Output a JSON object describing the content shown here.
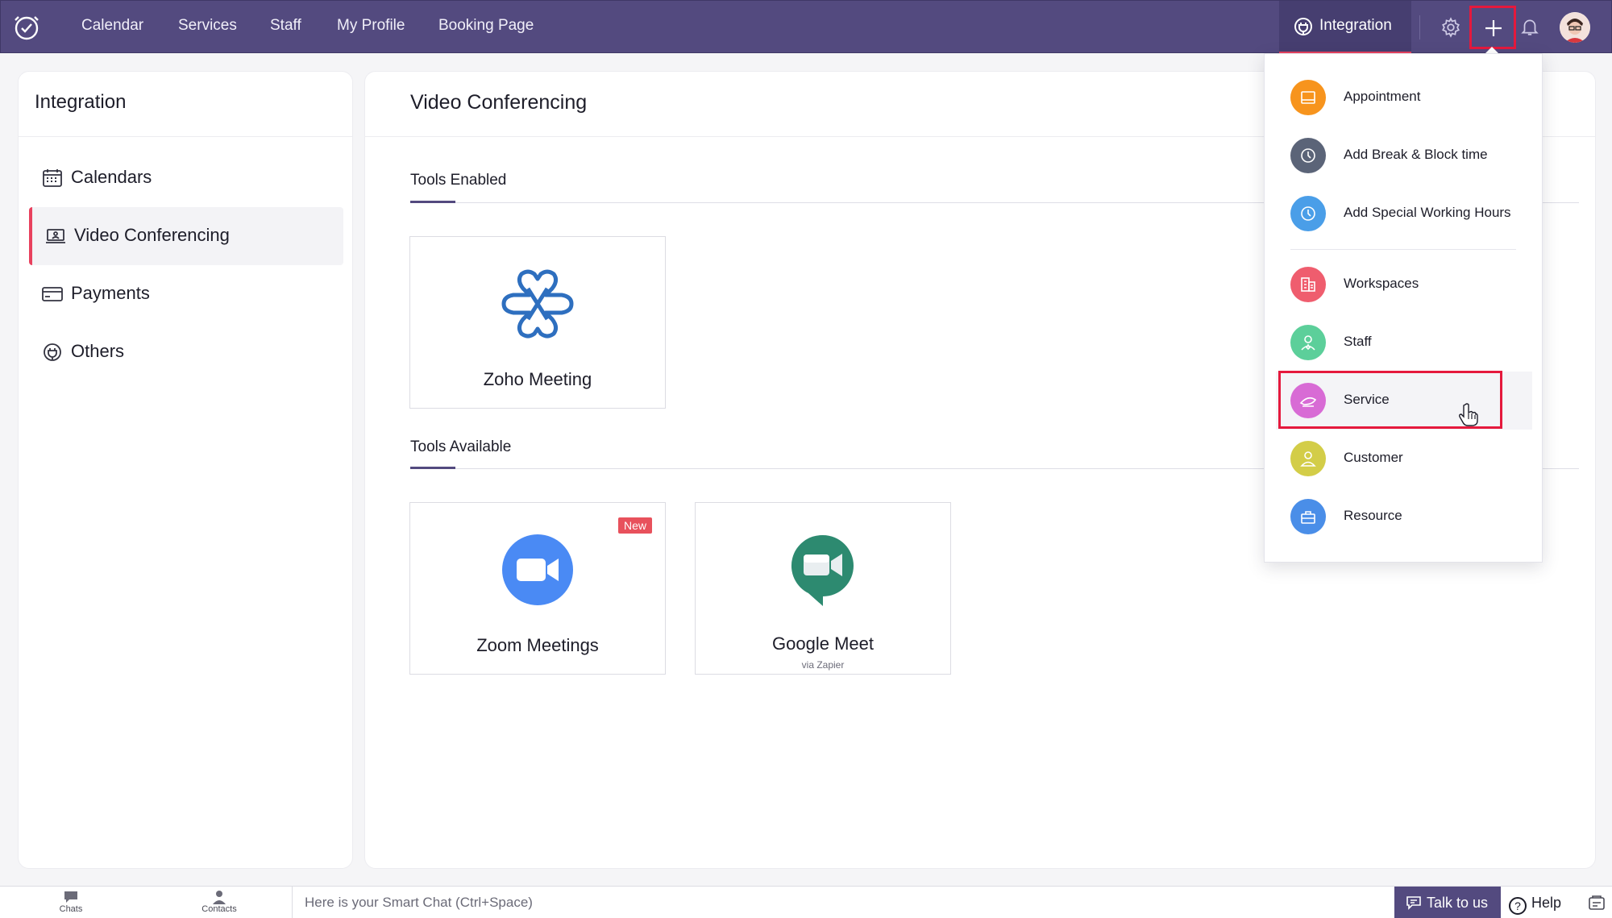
{
  "topnav": {
    "items": [
      "Calendar",
      "Services",
      "Staff",
      "My Profile",
      "Booking Page"
    ],
    "active_tab": "Integration"
  },
  "sidebar": {
    "title": "Integration",
    "items": [
      {
        "label": "Calendars",
        "icon": "calendar-icon"
      },
      {
        "label": "Video Conferencing",
        "icon": "laptop-icon"
      },
      {
        "label": "Payments",
        "icon": "card-icon"
      },
      {
        "label": "Others",
        "icon": "plug-icon"
      }
    ]
  },
  "main": {
    "title": "Video Conferencing",
    "tools_enabled": {
      "title": "Tools Enabled",
      "cards": [
        {
          "name": "Zoho Meeting"
        }
      ]
    },
    "tools_available": {
      "title": "Tools Available",
      "cards": [
        {
          "name": "Zoom Meetings",
          "badge": "New"
        },
        {
          "name": "Google Meet",
          "sub": "via Zapier"
        }
      ]
    }
  },
  "dropdown": {
    "items": [
      {
        "label": "Appointment",
        "color": "#f7941d",
        "icon": "calendar-icon"
      },
      {
        "label": "Add Break & Block time",
        "color": "#5b6478",
        "icon": "clock-icon"
      },
      {
        "label": "Add Special Working Hours",
        "color": "#4a9ee8",
        "icon": "clock-icon"
      },
      {
        "label": "Workspaces",
        "color": "#ef5d6e",
        "icon": "building-icon"
      },
      {
        "label": "Staff",
        "color": "#5ccf9a",
        "icon": "staff-icon"
      },
      {
        "label": "Service",
        "color": "#d86bd5",
        "icon": "service-icon"
      },
      {
        "label": "Customer",
        "color": "#d3cd48",
        "icon": "customer-icon"
      },
      {
        "label": "Resource",
        "color": "#4a8ee8",
        "icon": "resource-icon"
      }
    ]
  },
  "bottombar": {
    "chats": "Chats",
    "contacts": "Contacts",
    "smart_chat_placeholder": "Here is your Smart Chat (Ctrl+Space)",
    "talk_to_us": "Talk to us",
    "help": "Help"
  },
  "colors": {
    "topbar": "#534a7f",
    "accent": "#e8415e",
    "highlight": "#e5193d"
  }
}
